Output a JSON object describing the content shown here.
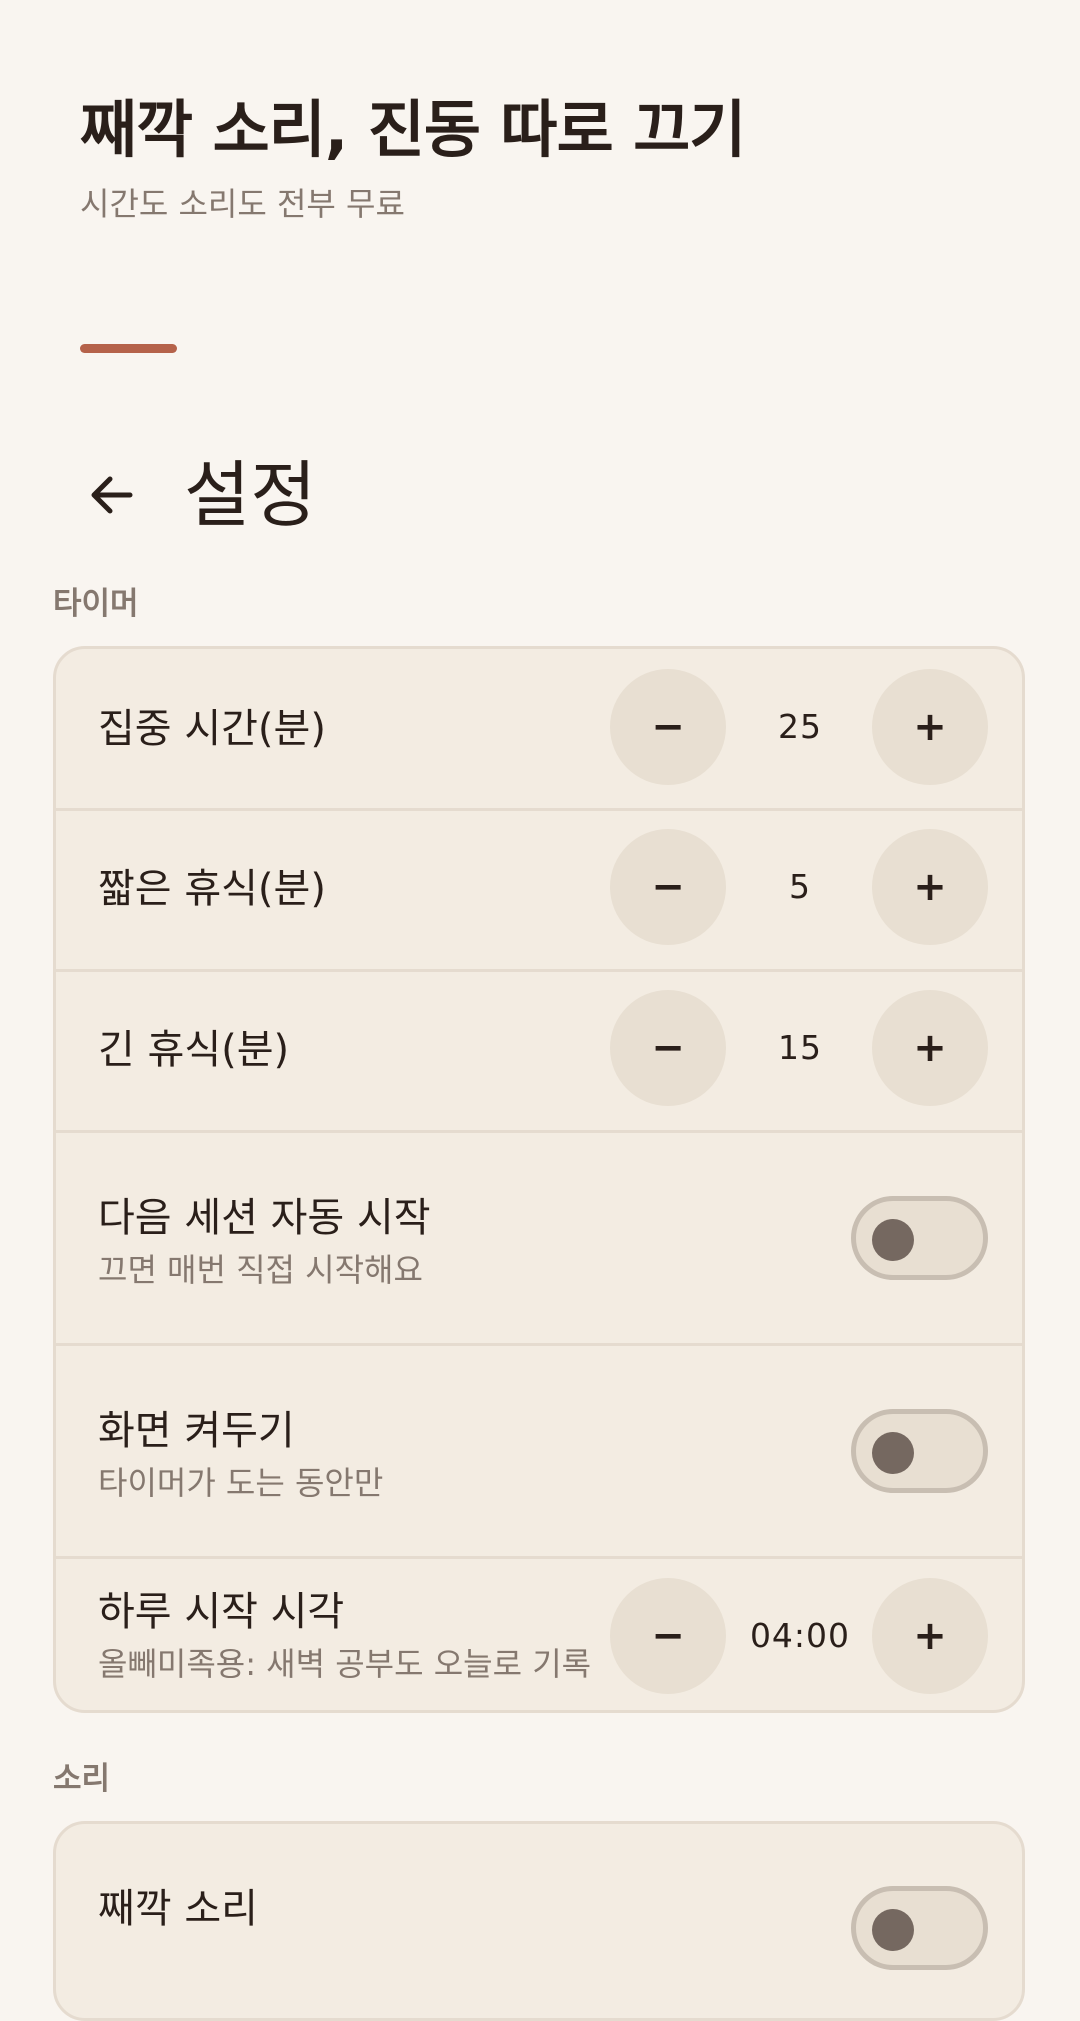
{
  "hero": {
    "title": "째깍 소리, 진동 따로 끄기",
    "subtitle": "시간도 소리도 전부 무료"
  },
  "appbar": {
    "back_icon": "arrow-left-icon",
    "title": "설정"
  },
  "sections": {
    "timer": {
      "label": "타이머",
      "focus": {
        "label": "집중 시간(분)",
        "value": "25",
        "decrement": "−",
        "increment": "+"
      },
      "short_break": {
        "label": "짧은 휴식(분)",
        "value": "5",
        "decrement": "−",
        "increment": "+"
      },
      "long_break": {
        "label": "긴 휴식(분)",
        "value": "15",
        "decrement": "−",
        "increment": "+"
      },
      "auto_start": {
        "label": "다음 세션 자동 시작",
        "description": "끄면 매번 직접 시작해요",
        "on": false
      },
      "keep_screen": {
        "label": "화면 켜두기",
        "description": "타이머가 도는 동안만",
        "on": false
      },
      "day_start": {
        "label": "하루 시작 시각",
        "description": "올빼미족용: 새벽 공부도 오늘로 기록",
        "value": "04:00",
        "decrement": "−",
        "increment": "+"
      }
    },
    "sound": {
      "label": "소리",
      "tick": {
        "label": "째깍 소리",
        "on": false
      }
    }
  },
  "colors": {
    "background": "#f9f5f0",
    "card": "#f3ece2",
    "accent": "#b5624a",
    "button": "#e8dfd2",
    "text": "#2a1f1a",
    "muted": "#85786f"
  }
}
